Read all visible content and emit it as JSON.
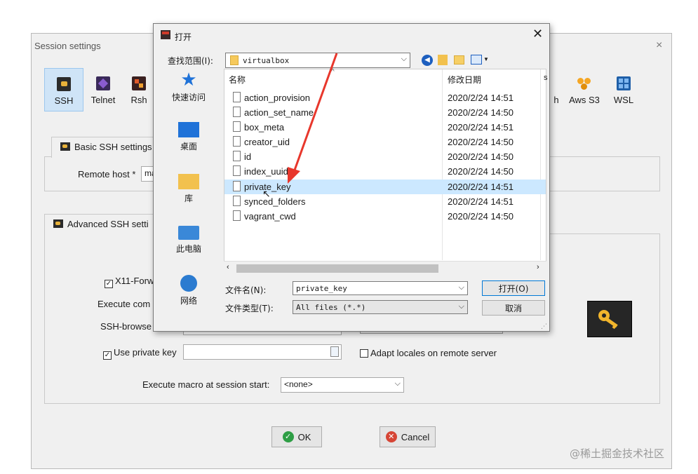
{
  "session": {
    "title": "Session settings",
    "close": "×",
    "tabs": [
      {
        "label": "SSH",
        "icon": "ssh-icon",
        "selected": true
      },
      {
        "label": "Telnet",
        "icon": "telnet-icon"
      },
      {
        "label": "Rsh",
        "icon": "rsh-icon"
      },
      {
        "label": "h",
        "icon": "mosh-icon"
      },
      {
        "label": "Aws S3",
        "icon": "aws-s3-icon"
      },
      {
        "label": "WSL",
        "icon": "wsl-icon"
      }
    ],
    "basic_tab": "Basic SSH settings",
    "remote_host_label": "Remote host *",
    "remote_host_value": "ma",
    "advanced_tab": "Advanced SSH setti",
    "x11_label": "X11-Forw",
    "execute_command_label": "Execute com",
    "ssh_browser_label": "SSH-browse",
    "use_private_key_label": "Use private key",
    "adapt_locales_label": "Adapt locales on remote server",
    "macro_label": "Execute macro at session start:",
    "macro_value": "<none>",
    "ok_label": "OK",
    "cancel_label": "Cancel"
  },
  "dialog": {
    "title": "打开",
    "close": "✕",
    "lookin_label": "查找范围(I):",
    "lookin_value": "virtualbox",
    "places": [
      {
        "label": "快速访问",
        "icon": "star-icon"
      },
      {
        "label": "桌面",
        "icon": "desktop-icon"
      },
      {
        "label": "库",
        "icon": "library-icon"
      },
      {
        "label": "此电脑",
        "icon": "computer-icon"
      },
      {
        "label": "网络",
        "icon": "network-icon"
      }
    ],
    "col_name": "名称",
    "col_date": "修改日期",
    "files": [
      {
        "name": "action_provision",
        "date": "2020/2/24 14:51"
      },
      {
        "name": "action_set_name",
        "date": "2020/2/24 14:50"
      },
      {
        "name": "box_meta",
        "date": "2020/2/24 14:51"
      },
      {
        "name": "creator_uid",
        "date": "2020/2/24 14:50"
      },
      {
        "name": "id",
        "date": "2020/2/24 14:50"
      },
      {
        "name": "index_uuid",
        "date": "2020/2/24 14:50"
      },
      {
        "name": "private_key",
        "date": "2020/2/24 14:51",
        "selected": true
      },
      {
        "name": "synced_folders",
        "date": "2020/2/24 14:51"
      },
      {
        "name": "vagrant_cwd",
        "date": "2020/2/24 14:50"
      }
    ],
    "filename_label": "文件名(N):",
    "filename_value": "private_key",
    "filetype_label": "文件类型(T):",
    "filetype_value": "All files (*.*)",
    "open_label": "打开(O)",
    "cancel_label": "取消"
  },
  "watermark": "@稀土掘金技术社区",
  "colors": {
    "arrow": "#e8372c",
    "selection": "#cce8ff",
    "accent": "#0078d7"
  }
}
